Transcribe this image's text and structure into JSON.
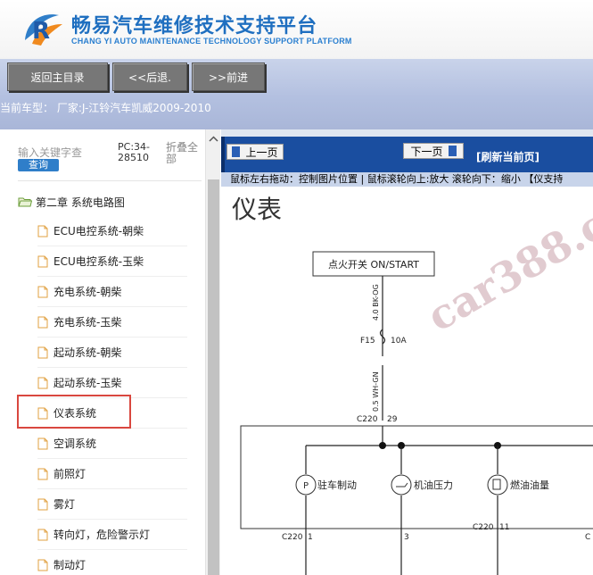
{
  "header": {
    "title": "畅易汽车维修技术支持平台",
    "subtitle": "CHANG YI AUTO MAINTENANCE TECHNOLOGY SUPPORT PLATFORM"
  },
  "toolbar": {
    "home_label": "返回主目录",
    "back_label": "<<后退.",
    "forward_label": ">>前进"
  },
  "car": {
    "label": "当前车型：  厂家:J-江铃汽车凯威2009-2010"
  },
  "sidebar": {
    "search_placeholder": "输入关键字查",
    "search_button": "查询",
    "pc_code": "PC:34-28510",
    "collapse_all": "折叠全部",
    "root_label": "第二章 系统电路图",
    "items": [
      {
        "label": "ECU电控系统-朝柴"
      },
      {
        "label": "ECU电控系统-玉柴"
      },
      {
        "label": "充电系统-朝柴"
      },
      {
        "label": "充电系统-玉柴"
      },
      {
        "label": "起动系统-朝柴"
      },
      {
        "label": "起动系统-玉柴"
      },
      {
        "label": "仪表系统"
      },
      {
        "label": "空调系统"
      },
      {
        "label": "前照灯"
      },
      {
        "label": "雾灯"
      },
      {
        "label": "转向灯，危险警示灯"
      },
      {
        "label": "制动灯"
      }
    ]
  },
  "viewer": {
    "prev_page": "上一页",
    "next_page": "下一页",
    "refresh": "[刷新当前页]",
    "hint": "鼠标左右拖动：控制图片位置 | 鼠标滚轮向上:放大  滚轮向下：缩小 【仪支持"
  },
  "diagram": {
    "title": "仪表",
    "ignition_switch": "点火开关 ON/START",
    "wire_top": "4.0 BK-OG",
    "fuse_name": "F15",
    "fuse_rating": "10A",
    "wire_bottom": "0.5 WH-GN",
    "connector_top": "C220",
    "connector_top_pin": "29",
    "gauge_parking": "驻车制动",
    "gauge_oil": "机油压力",
    "gauge_fuel": "燃油油量",
    "conn_a": "C220",
    "conn_a_pin": "1",
    "conn_b_pin": "3",
    "conn_c": "C220",
    "conn_c_pin": "11",
    "conn_d": "C",
    "watermark": "car388.com"
  },
  "colors": {
    "accent": "#1a4ea0",
    "highlight": "#d9473f",
    "toolbar_bg": "#b3c0e0"
  }
}
